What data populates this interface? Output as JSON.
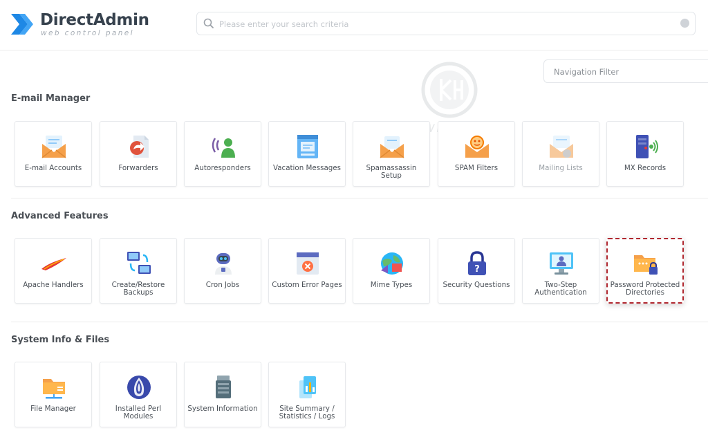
{
  "brand": {
    "name": "DirectAdmin",
    "tagline": "web control panel",
    "colors": {
      "primary": "#1e88e5",
      "dark": "#36414d"
    }
  },
  "search": {
    "placeholder": "Please enter your search criteria"
  },
  "nav_filter": {
    "placeholder": "Navigation Filter"
  },
  "watermark": {
    "text": "KnownHost"
  },
  "highlight_color": "#b0272f",
  "sections": [
    {
      "title": "E-mail Manager",
      "items": [
        {
          "label": "E-mail Accounts",
          "icon": "envelope-icon"
        },
        {
          "label": "Forwarders",
          "icon": "forward-document-icon"
        },
        {
          "label": "Autoresponders",
          "icon": "user-broadcast-icon"
        },
        {
          "label": "Vacation Messages",
          "icon": "vacation-window-icon"
        },
        {
          "label": "Spamassassin Setup",
          "icon": "spam-envelope-icon"
        },
        {
          "label": "SPAM Filters",
          "icon": "spam-filter-icon"
        },
        {
          "label": "Mailing Lists",
          "icon": "mailing-list-icon"
        },
        {
          "label": "MX Records",
          "icon": "mx-server-icon"
        }
      ]
    },
    {
      "title": "Advanced Features",
      "items": [
        {
          "label": "Apache Handlers",
          "icon": "apache-feather-icon"
        },
        {
          "label": "Create/Restore Backups",
          "icon": "backup-monitors-icon"
        },
        {
          "label": "Cron Jobs",
          "icon": "robot-icon"
        },
        {
          "label": "Custom Error Pages",
          "icon": "error-page-icon"
        },
        {
          "label": "Mime Types",
          "icon": "globe-mime-icon"
        },
        {
          "label": "Security Questions",
          "icon": "padlock-question-icon"
        },
        {
          "label": "Two-Step Authentication",
          "icon": "auth-monitor-icon"
        },
        {
          "label": "Password Protected Directories",
          "icon": "locked-folder-icon"
        }
      ]
    },
    {
      "title": "System Info & Files",
      "items": [
        {
          "label": "File Manager",
          "icon": "folder-icon"
        },
        {
          "label": "Installed Perl Modules",
          "icon": "perl-onion-icon"
        },
        {
          "label": "System Information",
          "icon": "server-info-icon"
        },
        {
          "label": "Site Summary / Statistics / Logs",
          "icon": "statistics-icon"
        }
      ]
    }
  ]
}
